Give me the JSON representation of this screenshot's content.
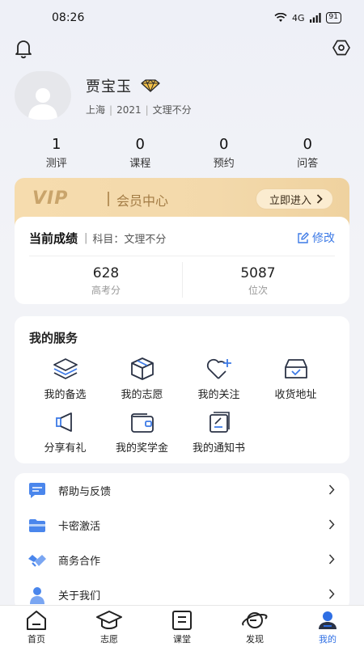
{
  "status_bar": {
    "time": "08:26",
    "network": "4G",
    "battery": "91"
  },
  "profile": {
    "name": "贾宝玉",
    "city": "上海",
    "year": "2021",
    "subject": "文理不分"
  },
  "stats": [
    {
      "value": "1",
      "label": "测评"
    },
    {
      "value": "0",
      "label": "课程"
    },
    {
      "value": "0",
      "label": "预约"
    },
    {
      "value": "0",
      "label": "问答"
    }
  ],
  "vip": {
    "logo": "VIP",
    "title": "会员中心",
    "button": "立即进入"
  },
  "score": {
    "title": "当前成绩",
    "subject_label": "科目：",
    "subject": "文理不分",
    "edit_label": "修改",
    "gaokao_value": "628",
    "gaokao_label": "高考分",
    "rank_value": "5087",
    "rank_label": "位次"
  },
  "services": {
    "title": "我的服务",
    "items": [
      {
        "label": "我的备选",
        "icon": "layers-icon"
      },
      {
        "label": "我的志愿",
        "icon": "box-icon"
      },
      {
        "label": "我的关注",
        "icon": "heart-plus-icon"
      },
      {
        "label": "收货地址",
        "icon": "inbox-icon"
      },
      {
        "label": "分享有礼",
        "icon": "speaker-icon"
      },
      {
        "label": "我的奖学金",
        "icon": "wallet-icon"
      },
      {
        "label": "我的通知书",
        "icon": "notice-icon"
      }
    ]
  },
  "menu": [
    {
      "label": "帮助与反馈",
      "icon": "chat-icon"
    },
    {
      "label": "卡密激活",
      "icon": "card-icon"
    },
    {
      "label": "商务合作",
      "icon": "handshake-icon"
    },
    {
      "label": "关于我们",
      "icon": "person-icon"
    }
  ],
  "tabs": [
    {
      "label": "首页",
      "icon": "home-icon"
    },
    {
      "label": "志愿",
      "icon": "graduation-cap-icon"
    },
    {
      "label": "课堂",
      "icon": "classroom-icon"
    },
    {
      "label": "发现",
      "icon": "planet-icon"
    },
    {
      "label": "我的",
      "icon": "profile-icon"
    }
  ],
  "colors": {
    "accent": "#3d7ae6",
    "vip_gold": "#f3d9ab",
    "vip_text": "#a37c45",
    "icon_dark": "#2b3346",
    "icon_blue": "#3d7ae6"
  }
}
